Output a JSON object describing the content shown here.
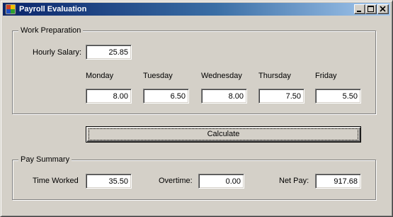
{
  "window": {
    "title": "Payroll Evaluation",
    "icons": {
      "app": "app-icon",
      "minimize": "minimize-icon",
      "maximize": "maximize-icon",
      "close": "close-icon"
    }
  },
  "work_preparation": {
    "group_title": "Work Preparation",
    "hourly_salary_label": "Hourly Salary:",
    "hourly_salary_value": "25.85",
    "days": [
      {
        "label": "Monday",
        "value": "8.00"
      },
      {
        "label": "Tuesday",
        "value": "6.50"
      },
      {
        "label": "Wednesday",
        "value": "8.00"
      },
      {
        "label": "Thursday",
        "value": "7.50"
      },
      {
        "label": "Friday",
        "value": "5.50"
      }
    ]
  },
  "calculate_label": "Calculate",
  "pay_summary": {
    "group_title": "Pay Summary",
    "time_worked_label": "Time Worked",
    "time_worked_value": "35.50",
    "overtime_label": "Overtime:",
    "overtime_value": "0.00",
    "net_pay_label": "Net Pay:",
    "net_pay_value": "917.68"
  }
}
